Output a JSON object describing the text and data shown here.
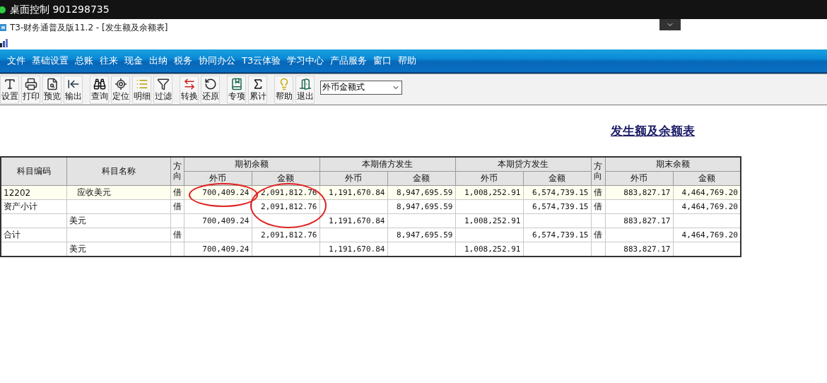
{
  "remote_bar": {
    "title": "桌面控制 901298735"
  },
  "window": {
    "title": "T3-财务通普及版11.2 - [发生额及余额表]"
  },
  "menu": [
    "文件",
    "基础设置",
    "总账",
    "往来",
    "现金",
    "出纳",
    "税务",
    "协同办公",
    "T3云体验",
    "学习中心",
    "产品服务",
    "窗口",
    "帮助"
  ],
  "toolbar": {
    "groups": [
      [
        "设置",
        "打印",
        "预览",
        "输出"
      ],
      [
        "查询",
        "定位",
        "明细",
        "过滤"
      ],
      [
        "转换",
        "还原"
      ],
      [
        "专项",
        "累计"
      ],
      [
        "帮助",
        "退出"
      ]
    ],
    "format_select": "外币金额式"
  },
  "report": {
    "title": "发生额及余额表"
  },
  "table": {
    "columns": [
      {
        "label": "科目编码"
      },
      {
        "label": "科目名称"
      },
      {
        "label": "方向"
      },
      {
        "label": "期初余额",
        "sub": [
          "外币",
          "金额"
        ]
      },
      {
        "label": "本期借方发生",
        "sub": [
          "外币",
          "金额"
        ]
      },
      {
        "label": "本期贷方发生",
        "sub": [
          "外币",
          "金额"
        ]
      },
      {
        "label": "方向"
      },
      {
        "label": "期末余额",
        "sub": [
          "外币",
          "金额"
        ]
      }
    ],
    "rows": [
      {
        "selected": true,
        "code": "12202",
        "name": "应收美元",
        "dir": "借",
        "open_fx": "700,409.24",
        "open_amt": "2,091,812.76",
        "dr_fx": "1,191,670.84",
        "dr_amt": "8,947,695.59",
        "cr_fx": "1,008,252.91",
        "cr_amt": "6,574,739.15",
        "dir2": "借",
        "end_fx": "883,827.17",
        "end_amt": "4,464,769.20",
        "circled": {
          "open_fx": true,
          "open_amt": true
        }
      },
      {
        "selected": false,
        "code": "资产小计",
        "dir": "借",
        "open_amt": "2,091,812.76",
        "circled": {
          "open_amt": true
        },
        "dr_amt": "8,947,695.59",
        "cr_amt": "6,574,739.15",
        "dir2": "借",
        "end_amt": "4,464,769.20"
      },
      {
        "selected": false,
        "currency": "美元",
        "open_fx": "700,409.24",
        "dr_fx": "1,191,670.84",
        "cr_fx": "1,008,252.91",
        "end_fx": "883,827.17"
      },
      {
        "selected": false,
        "code": "合计",
        "dir": "借",
        "open_amt": "2,091,812.76",
        "dr_amt": "8,947,695.59",
        "cr_amt": "6,574,739.15",
        "dir2": "借",
        "end_amt": "4,464,769.20"
      },
      {
        "selected": false,
        "currency": "美元",
        "open_fx": "700,409.24",
        "dr_fx": "1,191,670.84",
        "cr_fx": "1,008,252.91",
        "end_fx": "883,827.17"
      }
    ]
  }
}
